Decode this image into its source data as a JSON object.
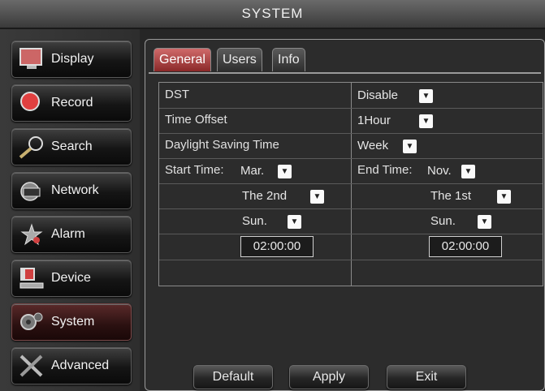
{
  "window": {
    "title": "SYSTEM"
  },
  "sidebar": {
    "items": [
      {
        "label": "Display",
        "icon": "monitor-icon"
      },
      {
        "label": "Record",
        "icon": "record-icon"
      },
      {
        "label": "Search",
        "icon": "search-icon"
      },
      {
        "label": "Network",
        "icon": "network-icon"
      },
      {
        "label": "Alarm",
        "icon": "alarm-icon"
      },
      {
        "label": "Device",
        "icon": "device-icon"
      },
      {
        "label": "System",
        "icon": "system-icon",
        "active": true
      },
      {
        "label": "Advanced",
        "icon": "advanced-icon"
      }
    ]
  },
  "tabs": [
    {
      "label": "General",
      "active": true
    },
    {
      "label": "Users"
    },
    {
      "label": "Info"
    }
  ],
  "form": {
    "dst_label": "DST",
    "dst_value": "Disable",
    "time_offset_label": "Time Offset",
    "time_offset_value": "1Hour",
    "dst_mode_label": "Daylight Saving Time",
    "dst_mode_value": "Week",
    "start_label": "Start Time:",
    "start_month": "Mar.",
    "start_week": "The 2nd",
    "start_day": "Sun.",
    "start_time": "02:00:00",
    "end_label": "End Time:",
    "end_month": "Nov.",
    "end_week": "The 1st",
    "end_day": "Sun.",
    "end_time": "02:00:00"
  },
  "buttons": {
    "default": "Default",
    "apply": "Apply",
    "exit": "Exit"
  },
  "colors": {
    "active_tab": "#b84040",
    "background": "#2a2a2a"
  }
}
